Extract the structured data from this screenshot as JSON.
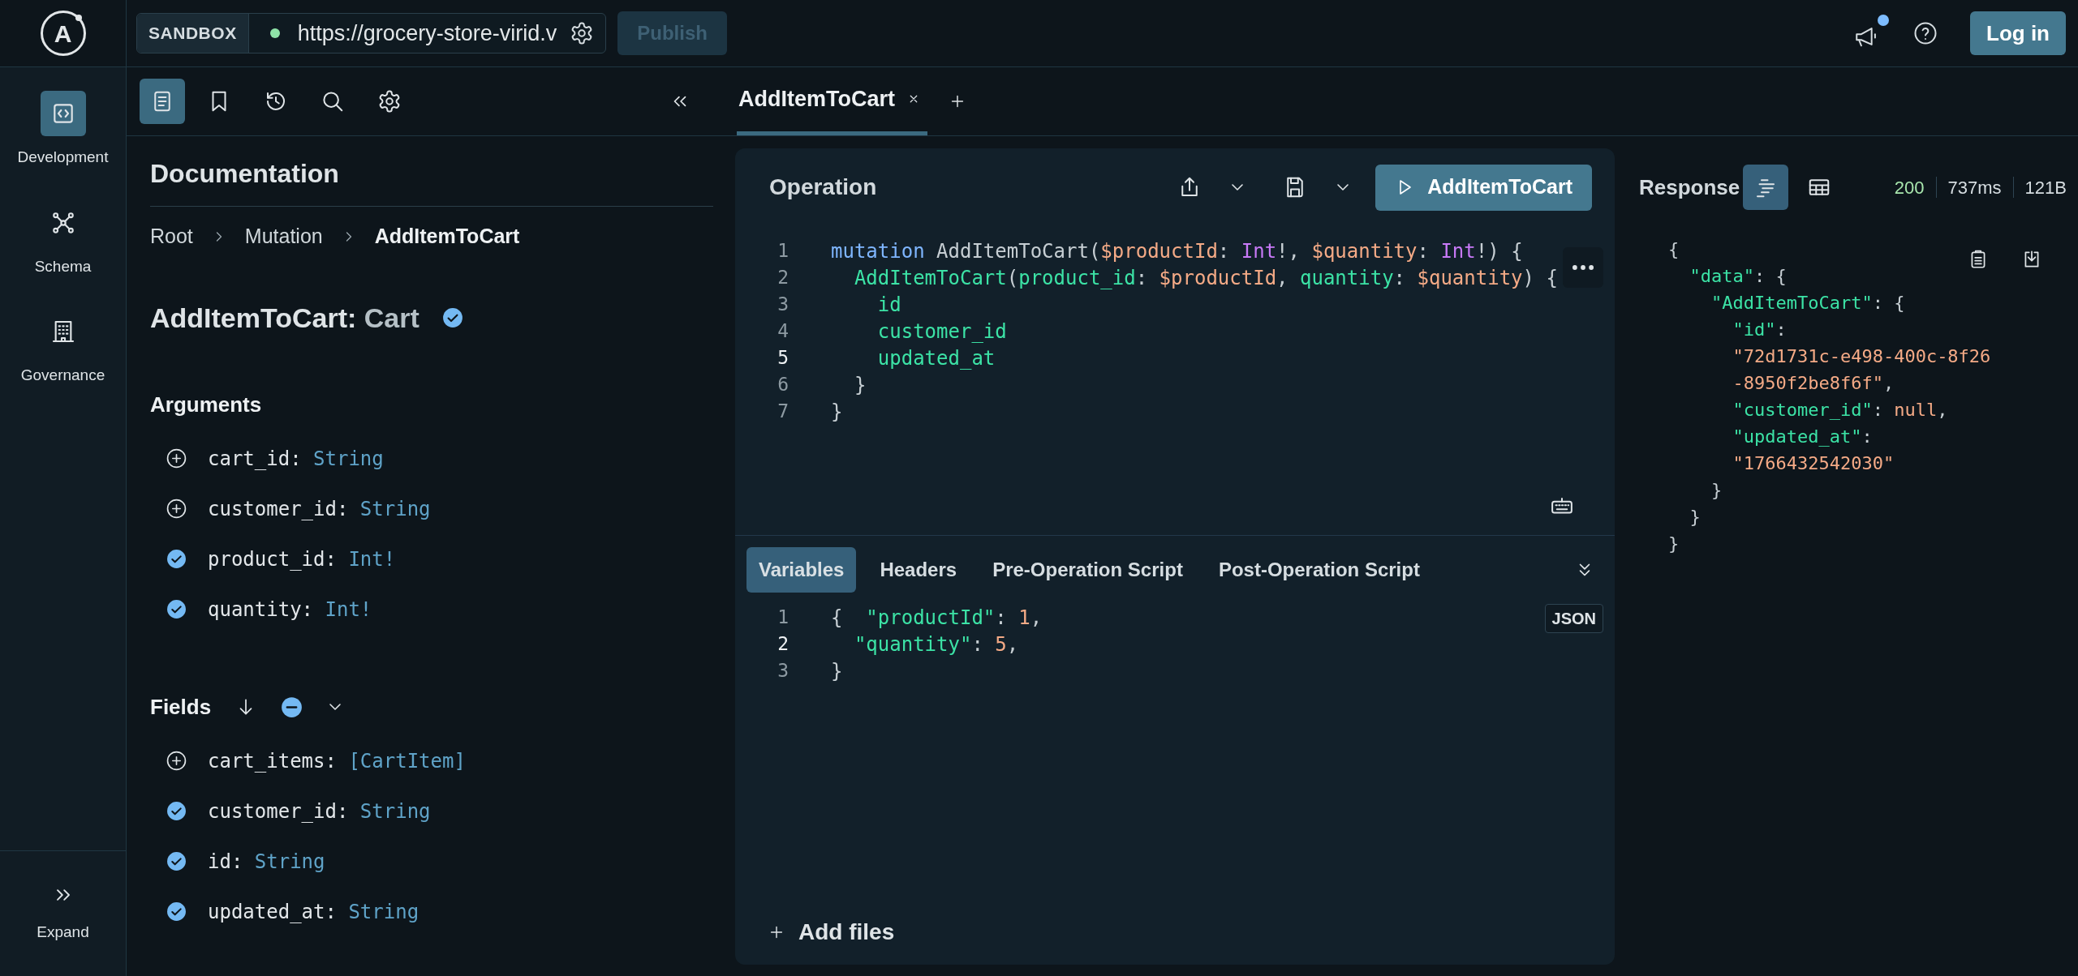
{
  "header": {
    "logo": "A",
    "environment": "SANDBOX",
    "connected": true,
    "url": "https://grocery-store-virid.v",
    "publish": {
      "label": "Publish",
      "disabled": true
    },
    "announcements_unread": true,
    "login": "Log in"
  },
  "nav": {
    "items": [
      {
        "kind": "development",
        "label": "Development",
        "selected": true
      },
      {
        "kind": "schema",
        "label": "Schema",
        "selected": false
      },
      {
        "kind": "governance",
        "label": "Governance",
        "selected": false
      }
    ],
    "expand": "Expand"
  },
  "docs_toolbar": [
    {
      "kind": "docs",
      "selected": true
    },
    {
      "kind": "bookmark",
      "selected": false
    },
    {
      "kind": "history",
      "selected": false
    },
    {
      "kind": "search",
      "selected": false
    },
    {
      "kind": "settings",
      "selected": false
    }
  ],
  "docs": {
    "title": "Documentation",
    "breadcrumb": [
      {
        "label": "Root",
        "current": false
      },
      {
        "label": "Mutation",
        "current": false
      },
      {
        "label": "AddItemToCart",
        "current": true
      }
    ],
    "heading": {
      "name": "AddItemToCart:",
      "type": "Cart",
      "checked": true
    },
    "arguments": {
      "title": "Arguments",
      "items": [
        {
          "name": "cart_id:",
          "type": "String",
          "checked": false
        },
        {
          "name": "customer_id:",
          "type": "String",
          "checked": false
        },
        {
          "name": "product_id:",
          "type": "Int!",
          "checked": true
        },
        {
          "name": "quantity:",
          "type": "Int!",
          "checked": true
        }
      ]
    },
    "fields": {
      "title": "Fields",
      "items": [
        {
          "name": "cart_items:",
          "type": "[CartItem]",
          "checked": false
        },
        {
          "name": "customer_id:",
          "type": "String",
          "checked": true
        },
        {
          "name": "id:",
          "type": "String",
          "checked": true
        },
        {
          "name": "updated_at:",
          "type": "String",
          "checked": true
        }
      ]
    }
  },
  "tabs": [
    {
      "label": "AddItemToCart",
      "selected": true
    }
  ],
  "operation": {
    "title": "Operation",
    "run_label": "AddItemToCart",
    "lines": [
      {
        "number": "1",
        "current": false,
        "tokens": [
          {
            "text": "mutation",
            "kind": "keyword"
          },
          {
            "text": " AddItemToCart(",
            "kind": "plain"
          },
          {
            "text": "$productId",
            "kind": "var"
          },
          {
            "text": ": ",
            "kind": "plain"
          },
          {
            "text": "Int",
            "kind": "type"
          },
          {
            "text": "!, ",
            "kind": "plain"
          },
          {
            "text": "$quantity",
            "kind": "var"
          },
          {
            "text": ": ",
            "kind": "plain"
          },
          {
            "text": "Int",
            "kind": "type"
          },
          {
            "text": "!) {",
            "kind": "plain"
          }
        ]
      },
      {
        "number": "2",
        "current": false,
        "tokens": [
          {
            "text": "  AddItemToCart",
            "kind": "field"
          },
          {
            "text": "(",
            "kind": "plain"
          },
          {
            "text": "product_id",
            "kind": "field"
          },
          {
            "text": ": ",
            "kind": "plain"
          },
          {
            "text": "$productId",
            "kind": "var"
          },
          {
            "text": ", ",
            "kind": "plain"
          },
          {
            "text": "quantity",
            "kind": "field"
          },
          {
            "text": ": ",
            "kind": "plain"
          },
          {
            "text": "$quantity",
            "kind": "var"
          },
          {
            "text": ") {",
            "kind": "plain"
          }
        ]
      },
      {
        "number": "3",
        "current": false,
        "tokens": [
          {
            "text": "    id",
            "kind": "field"
          }
        ]
      },
      {
        "number": "4",
        "current": false,
        "tokens": [
          {
            "text": "    customer_id",
            "kind": "field"
          }
        ]
      },
      {
        "number": "5",
        "current": true,
        "tokens": [
          {
            "text": "    updated_at",
            "kind": "field"
          }
        ]
      },
      {
        "number": "6",
        "current": false,
        "tokens": [
          {
            "text": "  }",
            "kind": "plain"
          }
        ]
      },
      {
        "number": "7",
        "current": false,
        "tokens": [
          {
            "text": "}",
            "kind": "plain"
          }
        ]
      }
    ]
  },
  "variables": {
    "tabs": [
      {
        "label": "Variables",
        "selected": true
      },
      {
        "label": "Headers",
        "selected": false
      },
      {
        "label": "Pre-Operation Script",
        "selected": false
      },
      {
        "label": "Post-Operation Script",
        "selected": false
      }
    ],
    "format": "JSON",
    "lines": [
      {
        "number": "1",
        "current": false,
        "tokens": [
          {
            "text": "{  ",
            "kind": "plain"
          },
          {
            "text": "\"productId\"",
            "kind": "field"
          },
          {
            "text": ": ",
            "kind": "plain"
          },
          {
            "text": "1",
            "kind": "number"
          },
          {
            "text": ",",
            "kind": "plain"
          }
        ]
      },
      {
        "number": "2",
        "current": true,
        "tokens": [
          {
            "text": "  \"quantity\"",
            "kind": "field"
          },
          {
            "text": ": ",
            "kind": "plain"
          },
          {
            "text": "5",
            "kind": "number"
          },
          {
            "text": ",",
            "kind": "plain"
          }
        ]
      },
      {
        "number": "3",
        "current": false,
        "tokens": [
          {
            "text": "}",
            "kind": "plain"
          }
        ]
      }
    ],
    "add_files": "Add files"
  },
  "response": {
    "title": "Response",
    "views": [
      {
        "kind": "json",
        "selected": true
      },
      {
        "kind": "table",
        "selected": false
      }
    ],
    "status": "200",
    "time": "737ms",
    "size": "121B",
    "lines": [
      {
        "tokens": [
          {
            "text": "{",
            "kind": "plain"
          }
        ]
      },
      {
        "tokens": [
          {
            "text": "  \"data\"",
            "kind": "field"
          },
          {
            "text": ": {",
            "kind": "plain"
          }
        ]
      },
      {
        "tokens": [
          {
            "text": "    \"AddItemToCart\"",
            "kind": "field"
          },
          {
            "text": ": {",
            "kind": "plain"
          }
        ]
      },
      {
        "tokens": [
          {
            "text": "      \"id\"",
            "kind": "field"
          },
          {
            "text": ":",
            "kind": "plain"
          }
        ]
      },
      {
        "tokens": [
          {
            "text": "      \"72d1731c-e498-400c-8f26",
            "kind": "string"
          }
        ]
      },
      {
        "tokens": [
          {
            "text": "      -8950f2be8f6f\"",
            "kind": "string"
          },
          {
            "text": ",",
            "kind": "plain"
          }
        ]
      },
      {
        "tokens": [
          {
            "text": "      \"customer_id\"",
            "kind": "field"
          },
          {
            "text": ": ",
            "kind": "plain"
          },
          {
            "text": "null",
            "kind": "null"
          },
          {
            "text": ",",
            "kind": "plain"
          }
        ]
      },
      {
        "tokens": [
          {
            "text": "      \"updated_at\"",
            "kind": "field"
          },
          {
            "text": ":",
            "kind": "plain"
          }
        ]
      },
      {
        "tokens": [
          {
            "text": "      \"1766432542030\"",
            "kind": "string"
          }
        ]
      },
      {
        "tokens": [
          {
            "text": "    }",
            "kind": "plain"
          }
        ]
      },
      {
        "tokens": [
          {
            "text": "  }",
            "kind": "plain"
          }
        ]
      },
      {
        "tokens": [
          {
            "text": "}",
            "kind": "plain"
          }
        ]
      }
    ]
  }
}
